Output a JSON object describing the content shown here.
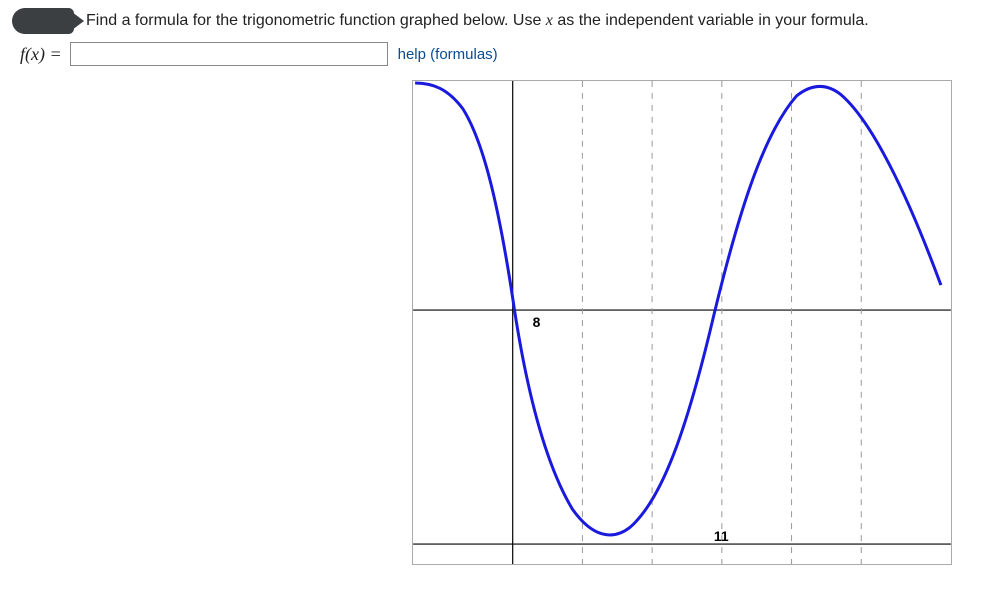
{
  "question": {
    "prefix": "Find a formula for the trigonometric function graphed below. Use ",
    "var": "x",
    "suffix": " as the independent variable in your formula."
  },
  "prompt": {
    "fx": "f(x) =",
    "placeholder": "",
    "value": ""
  },
  "help_link": "help (formulas)",
  "graph": {
    "labels": {
      "x_axis": "8",
      "x_tick": "11"
    }
  },
  "chart_data": {
    "type": "line",
    "title": "",
    "xlabel": "",
    "ylabel": "",
    "x_axis_label_value": 8,
    "visible_x_tick": 11,
    "vertical_dashed_gridlines_x": [
      9,
      10,
      11,
      12,
      13
    ],
    "dashed_gridline_spacing": 1,
    "horizontal_axis_y": 8,
    "curve_description": "Sinusoidal curve: enters upper-left descending, crosses y-axis near x≈8, reaches minimum between x≈9 and x≈10, ascends crossing midline near x≈11, reaches maximum near x≈12, then descends toward right edge.",
    "estimated_midline": 8,
    "series": [
      {
        "name": "f(x)",
        "color": "#1a1adf",
        "x": [
          6.0,
          6.5,
          7.0,
          7.5,
          8.0,
          8.5,
          9.0,
          9.5,
          10.0,
          10.5,
          11.0,
          11.5,
          12.0,
          12.5,
          13.0,
          13.5
        ],
        "y": [
          16.0,
          15.5,
          14.0,
          11.5,
          8.4,
          5.0,
          2.2,
          0.4,
          0.4,
          2.2,
          5.0,
          11.5,
          15.0,
          16.0,
          15.5,
          13.8
        ]
      }
    ]
  }
}
